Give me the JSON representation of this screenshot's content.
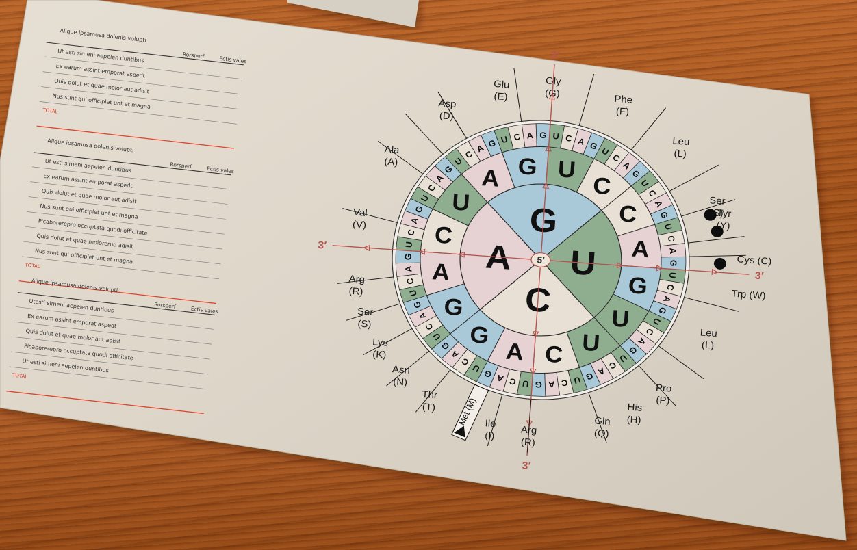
{
  "wheel": {
    "inner": [
      "G",
      "U",
      "C",
      "A"
    ],
    "middle": [
      "A",
      "G",
      "U",
      "C",
      "C",
      "A",
      "G",
      "U",
      "U",
      "C",
      "A",
      "G",
      "G",
      "A",
      "C",
      "U"
    ],
    "outer": [
      "U",
      "C",
      "A",
      "G",
      "U",
      "C",
      "A",
      "G",
      "U",
      "C",
      "A",
      "G",
      "U",
      "C",
      "A",
      "G",
      "U",
      "C",
      "A",
      "G",
      "U",
      "C",
      "A",
      "G",
      "U",
      "C",
      "A",
      "G",
      "U",
      "C",
      "A",
      "G",
      "U",
      "C",
      "A",
      "G",
      "U",
      "C",
      "A",
      "G",
      "U",
      "C",
      "A",
      "G",
      "U",
      "C",
      "A",
      "G",
      "U",
      "C",
      "A",
      "G",
      "U",
      "C",
      "A",
      "G",
      "U",
      "C",
      "A",
      "G",
      "U",
      "C",
      "A",
      "G"
    ],
    "center_label": "5′",
    "prime_labels": [
      "3′",
      "3′",
      "3′",
      "3′"
    ],
    "start_label": "Met (M)",
    "amino_acids": [
      {
        "name": "Gly",
        "code": "(G)"
      },
      {
        "name": "Phe",
        "code": "(F)"
      },
      {
        "name": "Leu",
        "code": "(L)"
      },
      {
        "name": "Ser",
        "code": "(S)"
      },
      {
        "name": "Tyr",
        "code": "(Y)"
      },
      {
        "name": "Cys",
        "code": "(C)"
      },
      {
        "name": "Trp",
        "code": "(W)"
      },
      {
        "name": "Leu",
        "code": "(L)"
      },
      {
        "name": "Pro",
        "code": "(P)"
      },
      {
        "name": "His",
        "code": "(H)"
      },
      {
        "name": "Gln",
        "code": "(Q)"
      },
      {
        "name": "Arg",
        "code": "(R)"
      },
      {
        "name": "Ile",
        "code": "(I)"
      },
      {
        "name": "Thr",
        "code": "(T)"
      },
      {
        "name": "Asn",
        "code": "(N)"
      },
      {
        "name": "Lys",
        "code": "(K)"
      },
      {
        "name": "Ser",
        "code": "(S)"
      },
      {
        "name": "Arg",
        "code": "(R)"
      },
      {
        "name": "Val",
        "code": "(V)"
      },
      {
        "name": "Ala",
        "code": "(A)"
      },
      {
        "name": "Asp",
        "code": "(D)"
      },
      {
        "name": "Glu",
        "code": "(E)"
      }
    ],
    "colors": {
      "green": "#8fae8f",
      "blue": "#a9c8d8",
      "pink": "#e6d2d3",
      "cream": "#e8e0d4",
      "axis": "#b5534f"
    }
  },
  "lists": [
    {
      "header": "Alique ipsamusa dolenis volupti",
      "col1": "Rorsperf",
      "col2": "Ectis vales",
      "rows": [
        "Ut esti simeni aepelen duntibus",
        "Ex earum assint emporat aspedt",
        "Quis dolut et quae molor aut adisit",
        "Nus sunt qui officiplet unt et magna"
      ],
      "total": "TOTAL"
    },
    {
      "header": "Alique ipsamusa dolenis volupti",
      "col1": "Rorsperf",
      "col2": "Ectis vales",
      "rows": [
        "Ut esti simeni aepelen duntibus",
        "Ex earum assint emporat aspedt",
        "Quis dolut et quae molor aut adisit",
        "Nus sunt qui officiplet unt et magna",
        "Picaborerepro occuptata quodi officitate",
        "Quis dolut et quae molorerud adisit",
        "Nus sunt qui officiplet unt et magna"
      ],
      "total": "TOTAL"
    },
    {
      "header": "Alique ipsamusa dolenis volupti",
      "col1": "Rorsperf",
      "col2": "Ectis vales",
      "rows": [
        "Utesti simeni aepelen duntibus",
        "Ex earum assint emporat aspedt",
        "Quis dolut et quae molor aut adisit",
        "Picaborerepro occuptata quodi officitate",
        "Ut esti simeni aepelen duntibus"
      ],
      "total": "TOTAL"
    }
  ]
}
